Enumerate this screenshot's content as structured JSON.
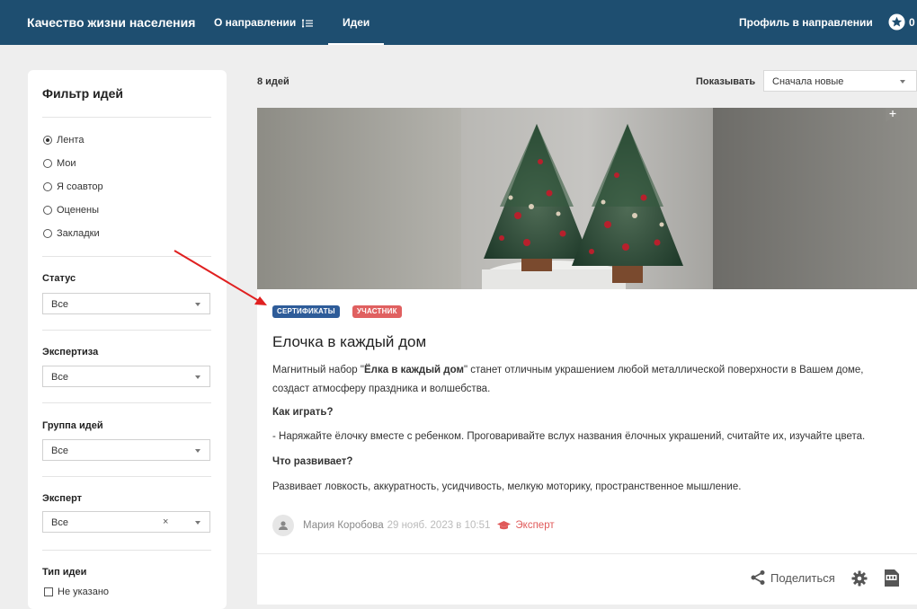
{
  "header": {
    "brand": "Качество жизни населения",
    "nav_about": "О направлении",
    "nav_ideas": "Идеи",
    "profile": "Профиль в направлении",
    "star_count": "0"
  },
  "sidebar": {
    "title": "Фильтр идей",
    "radios": [
      {
        "label": "Лента",
        "selected": true
      },
      {
        "label": "Мои",
        "selected": false
      },
      {
        "label": "Я соавтор",
        "selected": false
      },
      {
        "label": "Оценены",
        "selected": false
      },
      {
        "label": "Закладки",
        "selected": false
      }
    ],
    "status": {
      "label": "Статус",
      "value": "Все"
    },
    "expertise": {
      "label": "Экспертиза",
      "value": "Все"
    },
    "group": {
      "label": "Группа идей",
      "value": "Все"
    },
    "expert": {
      "label": "Эксперт",
      "value": "Все",
      "clear": "×"
    },
    "type": {
      "label": "Тип идеи",
      "checkbox": "Не указано"
    }
  },
  "main": {
    "count": "8 идей",
    "show_label": "Показывать",
    "sort_value": "Сначала новые"
  },
  "card": {
    "tags": [
      "СЕРТИФИКАТЫ",
      "УЧАСТНИК"
    ],
    "title": "Елочка в каждый дом",
    "desc_prefix": "Магнитный набор \"",
    "desc_bold": "Ёлка в каждый дом",
    "desc_suffix": "\" станет отличным украшением любой металлической поверхности в Вашем доме, создаст атмосферу праздника и волшебства.",
    "how_heading": "Как играть?",
    "how_text": "- Наряжайте ёлочку вместе с ребенком. Проговаривайте вслух названия ёлочных украшений, считайте их, изучайте цвета.",
    "dev_heading": "Что развивает?",
    "dev_text": "Развивает ловкость, аккуратность, усидчивость, мелкую моторику, пространственное мышление.",
    "author": "Мария Коробова",
    "date": "29 нояб. 2023 в 10:51",
    "role": "Эксперт",
    "share": "Поделиться"
  },
  "colors": {
    "topbar": "#1e4e70",
    "tag_cert": "#2e5c99",
    "tag_participant": "#e06060",
    "expert": "#e05a5a",
    "annotation_arrow": "#e02020"
  }
}
